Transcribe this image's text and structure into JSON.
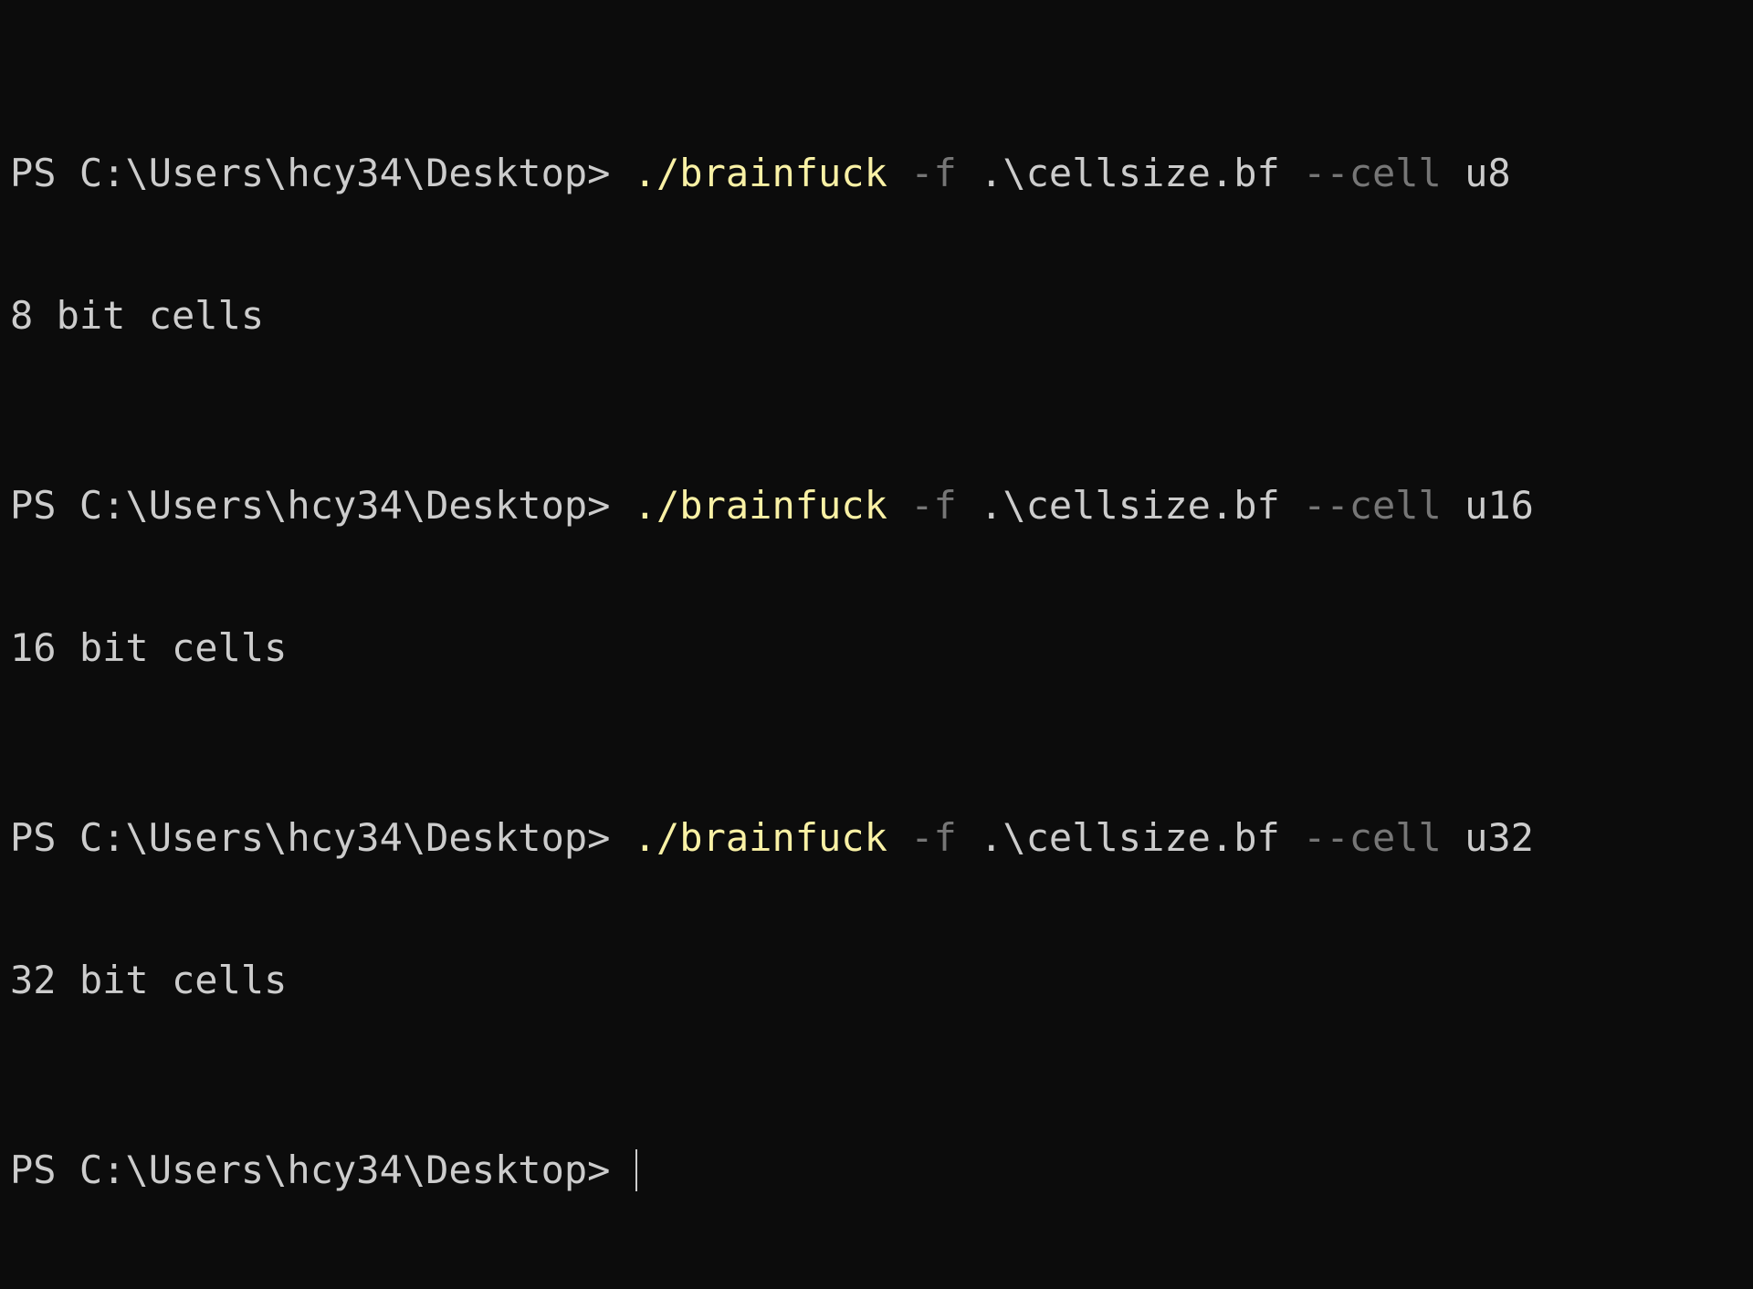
{
  "theme": {
    "background": "#0c0c0c",
    "foreground": "#cccccc",
    "command_color": "#f9f1a5",
    "flag_color": "#767676"
  },
  "prompt": "PS C:\\Users\\hcy34\\Desktop> ",
  "commands": [
    {
      "program": "./brainfuck",
      "flag_f": "-f",
      "file": ".\\cellsize.bf",
      "flag_cell": "--cell",
      "cell": "u8",
      "output": "8 bit cells"
    },
    {
      "program": "./brainfuck",
      "flag_f": "-f",
      "file": ".\\cellsize.bf",
      "flag_cell": "--cell",
      "cell": "u16",
      "output": "16 bit cells"
    },
    {
      "program": "./brainfuck",
      "flag_f": "-f",
      "file": ".\\cellsize.bf",
      "flag_cell": "--cell",
      "cell": "u32",
      "output": "32 bit cells"
    }
  ]
}
